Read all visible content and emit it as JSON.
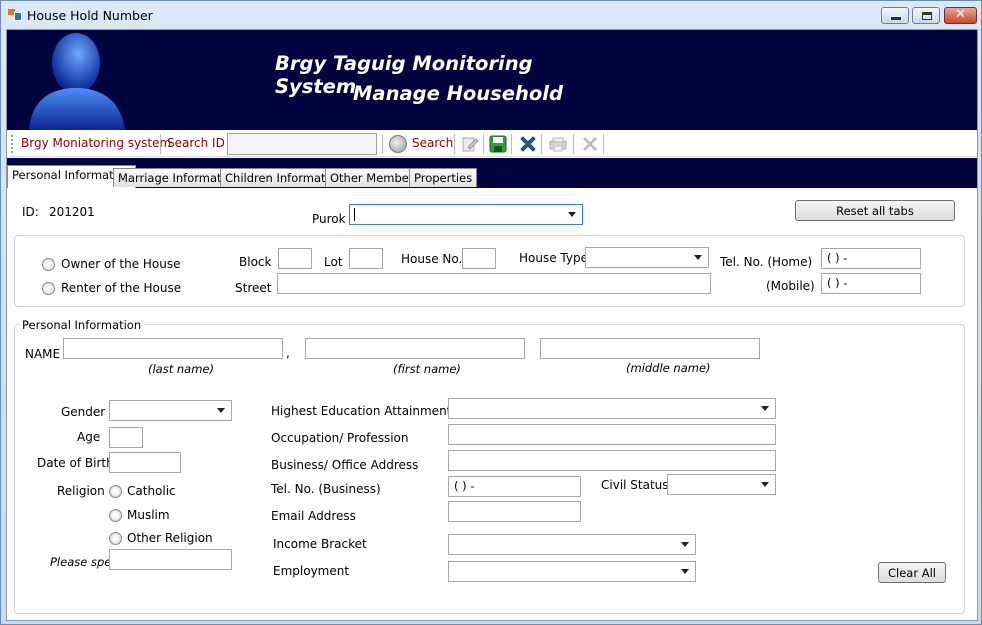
{
  "window": {
    "title": "House Hold Number",
    "close_glyph": "✕"
  },
  "banner": {
    "title": "Brgy Taguig Monitoring System",
    "subtitle": "Manage Household"
  },
  "toolbar": {
    "app_label": "Brgy Moniatoring system",
    "search_id_label": "Search ID",
    "search_id_value": "",
    "search_label": "Search",
    "icons": [
      "edit-icon",
      "save-icon",
      "delete-icon",
      "print-icon",
      "cancel-icon"
    ]
  },
  "tabs": [
    {
      "label": "Personal Information",
      "active": true
    },
    {
      "label": "Marriage Information",
      "active": false
    },
    {
      "label": "Children Information",
      "active": false
    },
    {
      "label": "Other Members",
      "active": false
    },
    {
      "label": "Properties",
      "active": false
    }
  ],
  "form": {
    "id_label": "ID:",
    "id_value": "201201",
    "purok_label": "Purok",
    "purok_value": "",
    "reset_button": "Reset all tabs",
    "house": {
      "owner_label": "Owner of the House",
      "renter_label": "Renter of the House",
      "block_label": "Block",
      "lot_label": "Lot",
      "house_no_label": "House No.",
      "house_type_label": "House Type",
      "tel_home_label": "Tel. No. (Home)",
      "tel_home_value": "(  )   -",
      "street_label": "Street",
      "mobile_label": "(Mobile)",
      "mobile_value": "(  )   -"
    },
    "personal": {
      "group_title": "Personal Information",
      "name_label": "NAME",
      "name_separator": ",",
      "last_name_hint": "(last name)",
      "first_name_hint": "(first name)",
      "middle_name_hint": "(middle name)",
      "gender_label": "Gender",
      "age_label": "Age",
      "dob_label": "Date of Birth",
      "religion_label": "Religion",
      "religion_options": [
        "Catholic",
        "Muslim",
        "Other Religion"
      ],
      "please_specify": "Please specify",
      "education_label": "Highest Education Attainment",
      "occupation_label": "Occupation/ Profession",
      "business_address_label": "Business/ Office Address",
      "tel_business_label": "Tel. No. (Business)",
      "tel_business_value": "(  )   -",
      "civil_status_label": "Civil Status",
      "email_label": "Email Address",
      "income_label": "Income Bracket",
      "employment_label": "Employment",
      "clear_button": "Clear All"
    }
  }
}
